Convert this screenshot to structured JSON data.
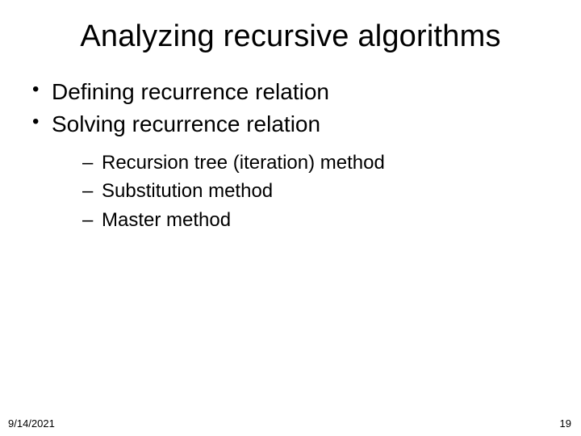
{
  "slide": {
    "title": "Analyzing recursive algorithms",
    "bullets": {
      "0": "Defining recurrence relation",
      "1": "Solving recurrence relation"
    },
    "subbullets": {
      "0": "Recursion tree (iteration) method",
      "1": "Substitution method",
      "2": "Master method"
    }
  },
  "footer": {
    "date": "9/14/2021",
    "page": "19"
  }
}
